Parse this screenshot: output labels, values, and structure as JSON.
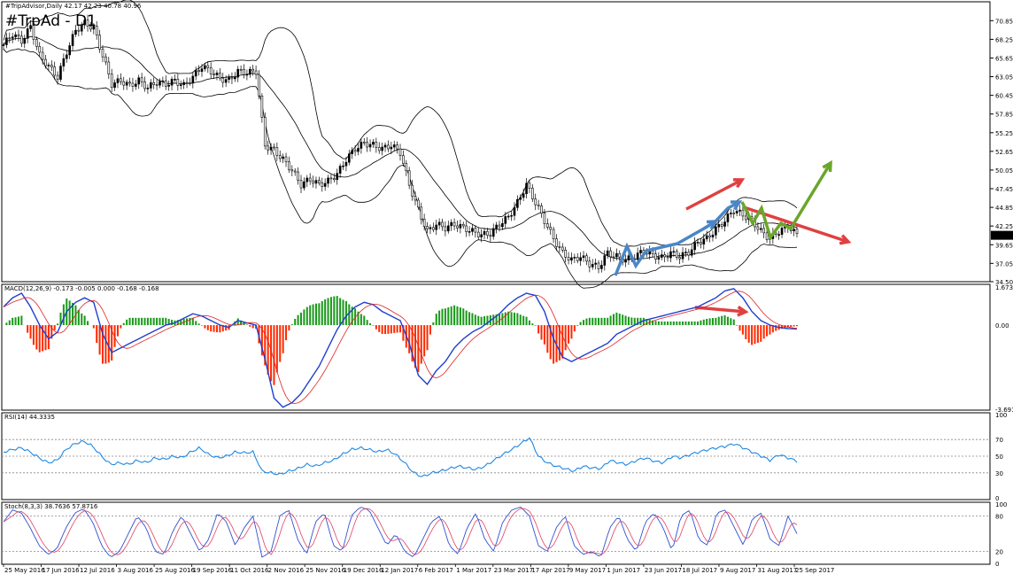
{
  "window": {
    "symbol_info": "#TripAdvisor,Daily  42.17 42.23 40.78 40.96",
    "title": "#TrpAd - D1"
  },
  "colors": {
    "bull_body": "#000000",
    "bear_body": "#ffffff",
    "bands": "#000000",
    "macd_line": "#1f3fd0",
    "signal_line": "#e02020",
    "hist_pos": "#1a9a1a",
    "hist_neg": "#ff2a00",
    "rsi": "#1e88e5",
    "stoch_main": "#3050d0",
    "stoch_signal": "#e04060",
    "arrow_blue": "#4a86c8",
    "arrow_red": "#e04040",
    "arrow_green": "#6aa62a",
    "price_tag_bg": "#000000",
    "price_tag_fg": "#ffffff"
  },
  "price_axis": [
    "70.85",
    "68.25",
    "65.65",
    "63.05",
    "60.45",
    "57.85",
    "55.25",
    "52.65",
    "50.05",
    "47.45",
    "44.85",
    "42.25",
    "39.65",
    "37.05",
    "34.50"
  ],
  "current_price": "40.96",
  "macd_panel": {
    "label": "MACD(12,26,9) -0.173 -0.005 0.000 -0.168 -0.168",
    "axis": [
      "1.673",
      "0.00",
      "-3.691"
    ]
  },
  "rsi_panel": {
    "label": "RSI(14) 44.3335",
    "axis": [
      "100",
      "70",
      "50",
      "30",
      "0"
    ]
  },
  "stoch_panel": {
    "label": "Stoch(8,3,3) 38.7636 57.8716",
    "axis": [
      "100",
      "80",
      "20",
      "0"
    ]
  },
  "date_axis": [
    "25 May 2016",
    "17 Jun 2016",
    "12 Jul 2016",
    "3 Aug 2016",
    "25 Aug 2016",
    "19 Sep 2016",
    "11 Oct 2016",
    "2 Nov 2016",
    "25 Nov 2016",
    "19 Dec 2016",
    "12 Jan 2017",
    "6 Feb 2017",
    "1 Mar 2017",
    "23 Mar 2017",
    "17 Apr 2017",
    "9 May 2017",
    "1 Jun 2017",
    "23 Jun 2017",
    "18 Jul 2017",
    "9 Aug 2017",
    "31 Aug 2017",
    "25 Sep 2017"
  ],
  "chart_data": {
    "type": "candlestick",
    "instrument": "#TripAdvisor,Daily",
    "ylim": [
      34.5,
      72.0
    ],
    "close_path": [
      [
        0,
        67.5
      ],
      [
        3,
        69.0
      ],
      [
        6,
        68.0
      ],
      [
        9,
        70.0
      ],
      [
        12,
        66.0
      ],
      [
        15,
        64.5
      ],
      [
        18,
        63.0
      ],
      [
        21,
        66.5
      ],
      [
        24,
        69.5
      ],
      [
        27,
        70.5
      ],
      [
        30,
        69.8
      ],
      [
        33,
        66.0
      ],
      [
        36,
        62.0
      ],
      [
        39,
        62.5
      ],
      [
        42,
        61.8
      ],
      [
        45,
        62.5
      ],
      [
        48,
        61.5
      ],
      [
        51,
        62.3
      ],
      [
        54,
        62.0
      ],
      [
        57,
        62.5
      ],
      [
        60,
        61.8
      ],
      [
        63,
        63.0
      ],
      [
        66,
        64.5
      ],
      [
        69,
        63.8
      ],
      [
        72,
        62.8
      ],
      [
        75,
        62.5
      ],
      [
        78,
        63.8
      ],
      [
        81,
        63.6
      ],
      [
        84,
        63.8
      ],
      [
        87,
        53.5
      ],
      [
        90,
        52.8
      ],
      [
        93,
        51.5
      ],
      [
        96,
        50.0
      ],
      [
        99,
        48.0
      ],
      [
        102,
        48.8
      ],
      [
        105,
        48.0
      ],
      [
        108,
        48.5
      ],
      [
        111,
        49.5
      ],
      [
        114,
        51.5
      ],
      [
        117,
        53.0
      ],
      [
        120,
        53.8
      ],
      [
        123,
        53.5
      ],
      [
        126,
        53.0
      ],
      [
        129,
        53.5
      ],
      [
        132,
        52.5
      ],
      [
        135,
        48.0
      ],
      [
        138,
        44.5
      ],
      [
        141,
        41.5
      ],
      [
        144,
        42.5
      ],
      [
        147,
        42.0
      ],
      [
        150,
        42.5
      ],
      [
        153,
        42.0
      ],
      [
        156,
        41.5
      ],
      [
        159,
        41.0
      ],
      [
        162,
        41.2
      ],
      [
        165,
        42.5
      ],
      [
        168,
        43.5
      ],
      [
        171,
        45.5
      ],
      [
        174,
        48.0
      ],
      [
        177,
        45.5
      ],
      [
        180,
        43.0
      ],
      [
        183,
        40.5
      ],
      [
        186,
        38.5
      ],
      [
        189,
        37.5
      ],
      [
        192,
        38.0
      ],
      [
        195,
        37.0
      ],
      [
        198,
        36.5
      ],
      [
        201,
        38.5
      ],
      [
        204,
        38.0
      ],
      [
        207,
        37.5
      ],
      [
        210,
        38.0
      ],
      [
        213,
        38.8
      ],
      [
        216,
        38.2
      ],
      [
        219,
        37.8
      ],
      [
        222,
        38.5
      ],
      [
        225,
        38.0
      ],
      [
        228,
        38.6
      ],
      [
        231,
        40.0
      ],
      [
        234,
        40.5
      ],
      [
        237,
        41.8
      ],
      [
        240,
        43.0
      ],
      [
        243,
        44.5
      ],
      [
        246,
        43.8
      ],
      [
        249,
        43.0
      ],
      [
        252,
        41.5
      ],
      [
        255,
        40.5
      ],
      [
        258,
        41.5
      ],
      [
        261,
        42.3
      ],
      [
        264,
        41.0
      ]
    ],
    "rsi": [
      55,
      58,
      60,
      55,
      48,
      42,
      45,
      58,
      65,
      68,
      62,
      50,
      40,
      42,
      40,
      45,
      42,
      48,
      46,
      50,
      48,
      55,
      60,
      52,
      48,
      50,
      55,
      54,
      55,
      32,
      30,
      28,
      32,
      35,
      40,
      38,
      42,
      45,
      52,
      58,
      60,
      58,
      55,
      58,
      52,
      42,
      30,
      25,
      30,
      32,
      35,
      38,
      36,
      34,
      38,
      45,
      52,
      58,
      65,
      72,
      50,
      42,
      38,
      35,
      32,
      38,
      36,
      35,
      45,
      42,
      40,
      45,
      48,
      44,
      42,
      50,
      48,
      52,
      55,
      58,
      60,
      62,
      65,
      60,
      55,
      50,
      45,
      52,
      48,
      44
    ],
    "stoch": [
      70,
      90,
      85,
      60,
      30,
      15,
      25,
      60,
      85,
      92,
      70,
      30,
      10,
      20,
      50,
      80,
      60,
      20,
      15,
      55,
      80,
      50,
      20,
      40,
      85,
      70,
      30,
      60,
      80,
      10,
      20,
      80,
      90,
      40,
      15,
      70,
      85,
      30,
      20,
      80,
      95,
      90,
      60,
      30,
      50,
      20,
      10,
      40,
      70,
      80,
      30,
      15,
      60,
      85,
      40,
      20,
      70,
      90,
      95,
      80,
      30,
      20,
      60,
      80,
      30,
      15,
      20,
      10,
      60,
      80,
      40,
      20,
      70,
      85,
      60,
      20,
      80,
      90,
      40,
      30,
      85,
      90,
      60,
      30,
      75,
      85,
      40,
      30,
      80,
      50
    ],
    "macd": [
      0.8,
      1.2,
      1.4,
      0.8,
      0.0,
      -0.6,
      -0.3,
      0.6,
      1.0,
      1.2,
      1.0,
      -0.4,
      -1.2,
      -1.0,
      -0.8,
      -0.6,
      -0.4,
      -0.2,
      0.0,
      0.1,
      0.3,
      0.5,
      0.4,
      0.2,
      0.0,
      -0.1,
      0.2,
      0.1,
      0.0,
      -1.5,
      -3.2,
      -3.6,
      -3.4,
      -3.0,
      -2.4,
      -1.8,
      -1.0,
      -0.2,
      0.4,
      0.8,
      1.0,
      0.9,
      0.6,
      0.4,
      0.2,
      -0.8,
      -2.2,
      -2.6,
      -2.0,
      -1.6,
      -1.0,
      -0.6,
      -0.3,
      -0.1,
      0.2,
      0.5,
      0.9,
      1.2,
      1.4,
      1.3,
      0.6,
      -0.6,
      -1.4,
      -1.6,
      -1.4,
      -1.2,
      -1.0,
      -0.8,
      -0.4,
      -0.2,
      0.0,
      0.2,
      0.3,
      0.4,
      0.5,
      0.6,
      0.7,
      0.8,
      1.0,
      1.2,
      1.5,
      1.6,
      1.2,
      0.6,
      0.2,
      0.0,
      -0.1,
      -0.15,
      -0.17
    ],
    "legend": "none"
  }
}
